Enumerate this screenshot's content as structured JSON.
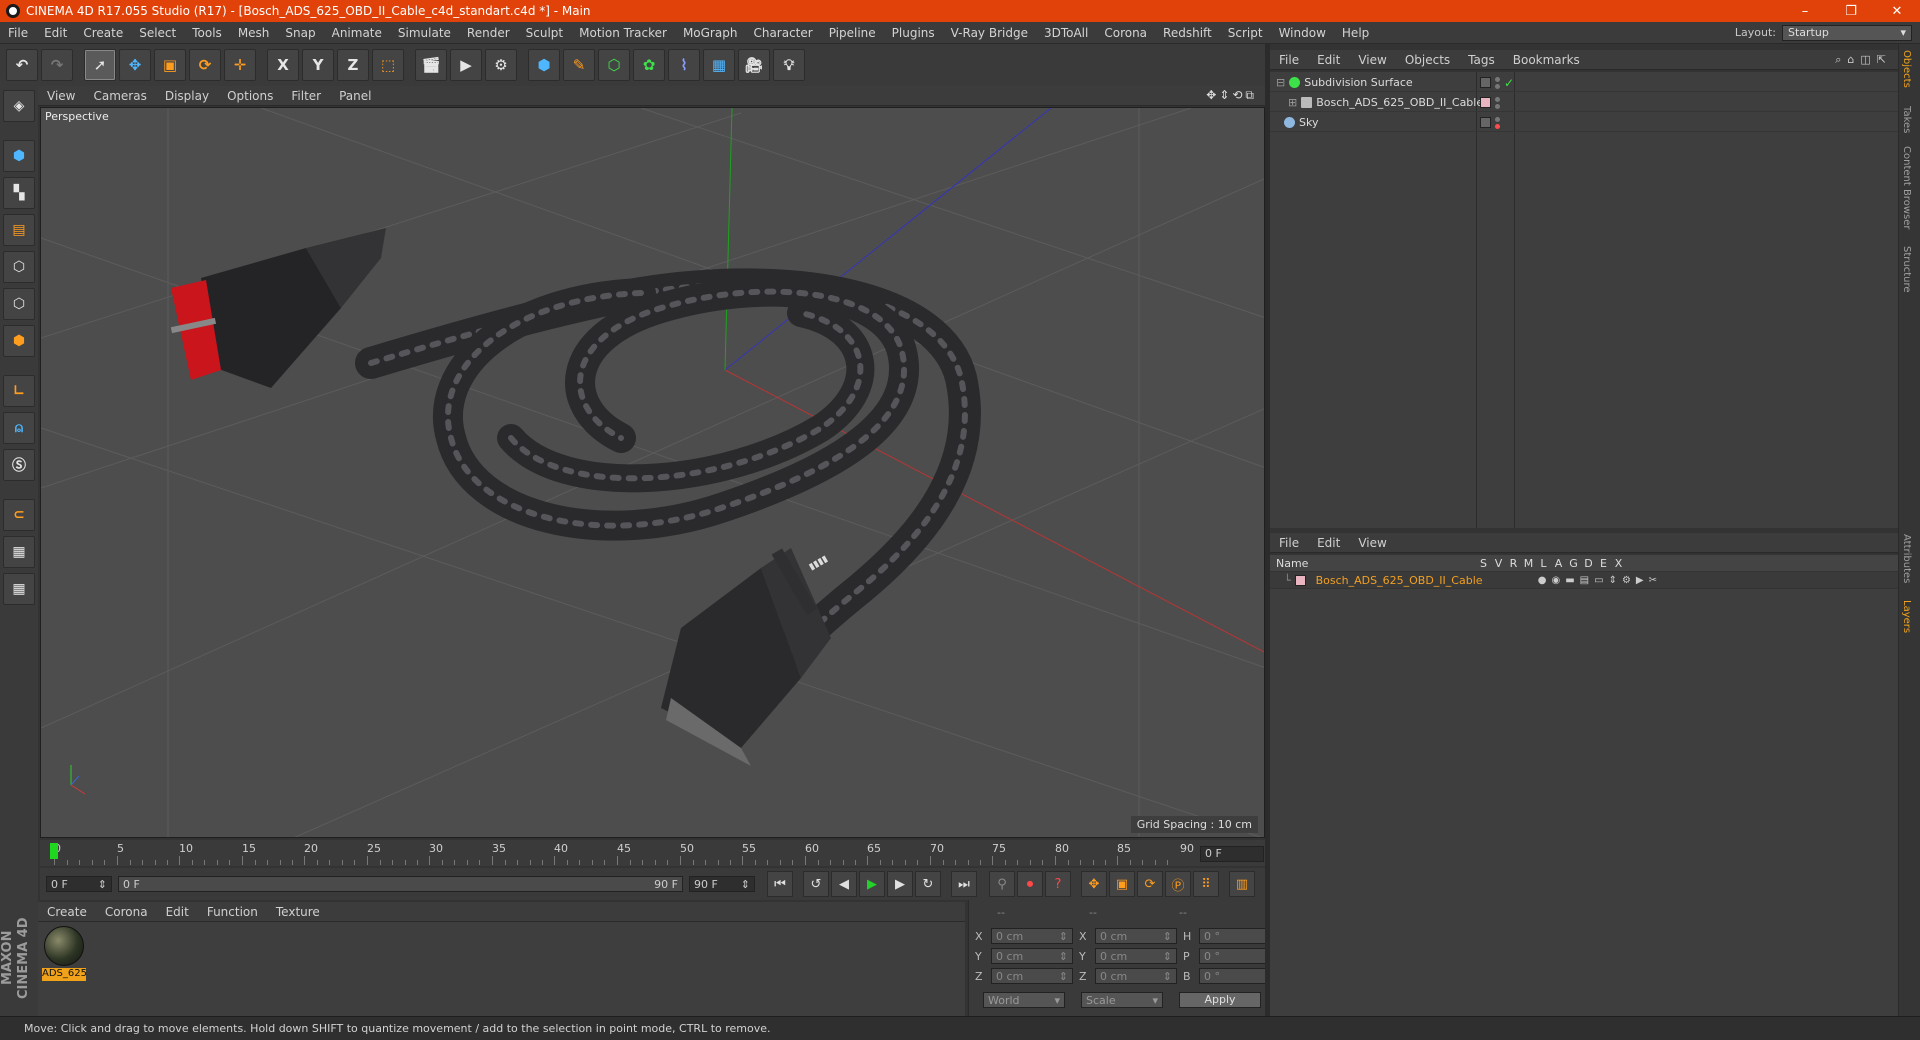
{
  "window": {
    "title": "CINEMA 4D R17.055 Studio (R17) - [Bosch_ADS_625_OBD_II_Cable_c4d_standart.c4d *] - Main",
    "controls": [
      "–",
      "❐",
      "✕"
    ]
  },
  "menubar": {
    "items": [
      "File",
      "Edit",
      "Create",
      "Select",
      "Tools",
      "Mesh",
      "Snap",
      "Animate",
      "Simulate",
      "Render",
      "Sculpt",
      "Motion Tracker",
      "MoGraph",
      "Character",
      "Pipeline",
      "Plugins",
      "V-Ray Bridge",
      "3DToAll",
      "Corona",
      "Redshift",
      "Script",
      "Window",
      "Help"
    ],
    "layout_label": "Layout:",
    "layout_value": "Startup"
  },
  "toolbar": {
    "axis_x": "X",
    "axis_y": "Y",
    "axis_z": "Z"
  },
  "viewport": {
    "menu": [
      "View",
      "Cameras",
      "Display",
      "Options",
      "Filter",
      "Panel"
    ],
    "label": "Perspective",
    "grid_spacing": "Grid Spacing : 10 cm"
  },
  "timeline": {
    "frames": [
      "0",
      "5",
      "10",
      "15",
      "20",
      "25",
      "30",
      "35",
      "40",
      "45",
      "50",
      "55",
      "60",
      "65",
      "70",
      "75",
      "80",
      "85",
      "90"
    ],
    "current": "0 F",
    "start": "0 F",
    "range_start": "0 F",
    "range_end": "90 F",
    "end": "90 F"
  },
  "material_manager": {
    "menu": [
      "Create",
      "Corona",
      "Edit",
      "Function",
      "Texture"
    ],
    "material_name": "ADS_625"
  },
  "coords": {
    "headers": [
      "--",
      "--",
      "--"
    ],
    "rows": [
      {
        "l1": "X",
        "v1": "0 cm",
        "l2": "X",
        "v2": "0 cm",
        "l3": "H",
        "v3": "0 °"
      },
      {
        "l1": "Y",
        "v1": "0 cm",
        "l2": "Y",
        "v2": "0 cm",
        "l3": "P",
        "v3": "0 °"
      },
      {
        "l1": "Z",
        "v1": "0 cm",
        "l2": "Z",
        "v2": "0 cm",
        "l3": "B",
        "v3": "0 °"
      }
    ],
    "mode1": "World",
    "mode2": "Scale",
    "apply": "Apply"
  },
  "object_manager": {
    "menu": [
      "File",
      "Edit",
      "View",
      "Objects",
      "Tags",
      "Bookmarks"
    ],
    "objects": [
      "Subdivision Surface",
      "Bosch_ADS_625_OBD_II_Cable",
      "Sky"
    ]
  },
  "layer_manager": {
    "menu": [
      "File",
      "Edit",
      "View"
    ],
    "name_col": "Name",
    "cols": [
      "S",
      "V",
      "R",
      "M",
      "L",
      "A",
      "G",
      "D",
      "E",
      "X"
    ],
    "layer_name": "Bosch_ADS_625_OBD_II_Cable"
  },
  "right_tabs": [
    "Objects",
    "Takes",
    "Content Browser",
    "Structure",
    "Attributes",
    "Layers"
  ],
  "logo": "MAXON CINEMA 4D",
  "status": "Move: Click and drag to move elements. Hold down SHIFT to quantize movement / add to the selection in point mode, CTRL to remove."
}
